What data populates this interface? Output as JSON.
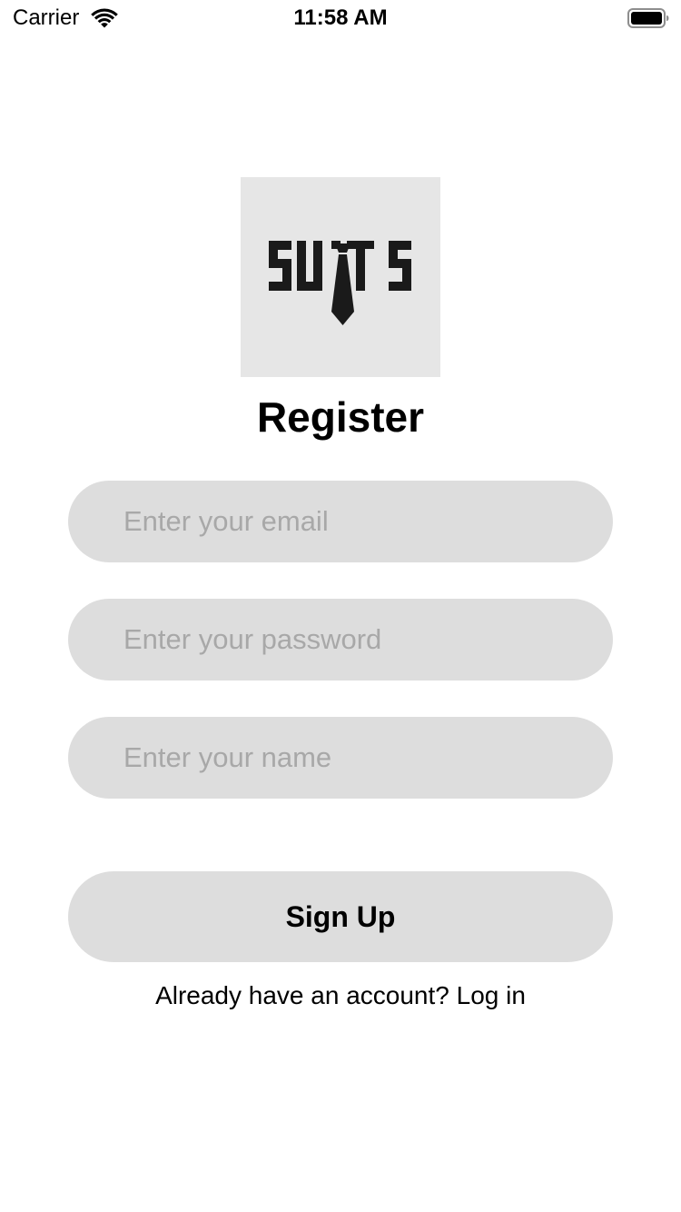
{
  "status_bar": {
    "carrier": "Carrier",
    "time": "11:58 AM",
    "wifi_icon": "wifi-icon",
    "battery_icon": "battery-icon"
  },
  "logo": {
    "text": "SUITS",
    "icon": "tie-icon",
    "background": "#e6e6e6"
  },
  "title": "Register",
  "form": {
    "email_placeholder": "Enter your email",
    "email_value": "",
    "password_placeholder": "Enter your password",
    "password_value": "",
    "name_placeholder": "Enter your name",
    "name_value": ""
  },
  "signup_label": "Sign Up",
  "login_prompt": "Already have an account? Log in",
  "colors": {
    "field_background": "#dddddd",
    "placeholder": "#a8a8a8"
  }
}
